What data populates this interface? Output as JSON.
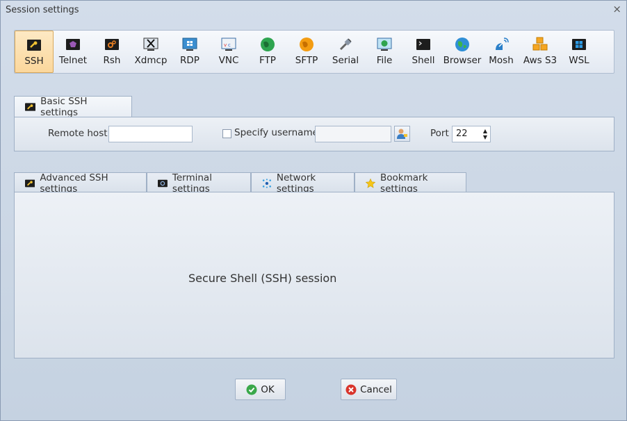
{
  "window": {
    "title": "Session settings",
    "close_glyph": "×"
  },
  "protocols": [
    {
      "label": "SSH",
      "icon": "ssh-key-icon",
      "selected": true
    },
    {
      "label": "Telnet",
      "icon": "telnet-icon"
    },
    {
      "label": "Rsh",
      "icon": "rsh-icon"
    },
    {
      "label": "Xdmcp",
      "icon": "xdmcp-icon"
    },
    {
      "label": "RDP",
      "icon": "rdp-icon"
    },
    {
      "label": "VNC",
      "icon": "vnc-icon"
    },
    {
      "label": "FTP",
      "icon": "ftp-globe-icon"
    },
    {
      "label": "SFTP",
      "icon": "sftp-globe-icon"
    },
    {
      "label": "Serial",
      "icon": "serial-plug-icon"
    },
    {
      "label": "File",
      "icon": "file-monitor-icon"
    },
    {
      "label": "Shell",
      "icon": "shell-terminal-icon"
    },
    {
      "label": "Browser",
      "icon": "browser-globe-icon"
    },
    {
      "label": "Mosh",
      "icon": "mosh-satellite-icon"
    },
    {
      "label": "Aws S3",
      "icon": "aws-s3-cubes-icon"
    },
    {
      "label": "WSL",
      "icon": "wsl-windows-icon"
    }
  ],
  "basic": {
    "tab_label": "Basic SSH settings",
    "remote_host_label": "Remote host *",
    "remote_host_value": "",
    "specify_username_label": "Specify username",
    "specify_username_checked": false,
    "username_value": "",
    "port_label": "Port",
    "port_value": "22"
  },
  "advanced_tabs": [
    {
      "label": "Advanced SSH settings",
      "icon": "ssh-key-icon"
    },
    {
      "label": "Terminal settings",
      "icon": "terminal-gear-icon"
    },
    {
      "label": "Network settings",
      "icon": "network-icon"
    },
    {
      "label": "Bookmark settings",
      "icon": "star-icon"
    }
  ],
  "session_description": "Secure Shell (SSH) session",
  "buttons": {
    "ok_label": "OK",
    "cancel_label": "Cancel"
  },
  "colors": {
    "selected_bg": "#fbd79c",
    "ok_green": "#3aa84a",
    "cancel_red": "#d9342b"
  }
}
